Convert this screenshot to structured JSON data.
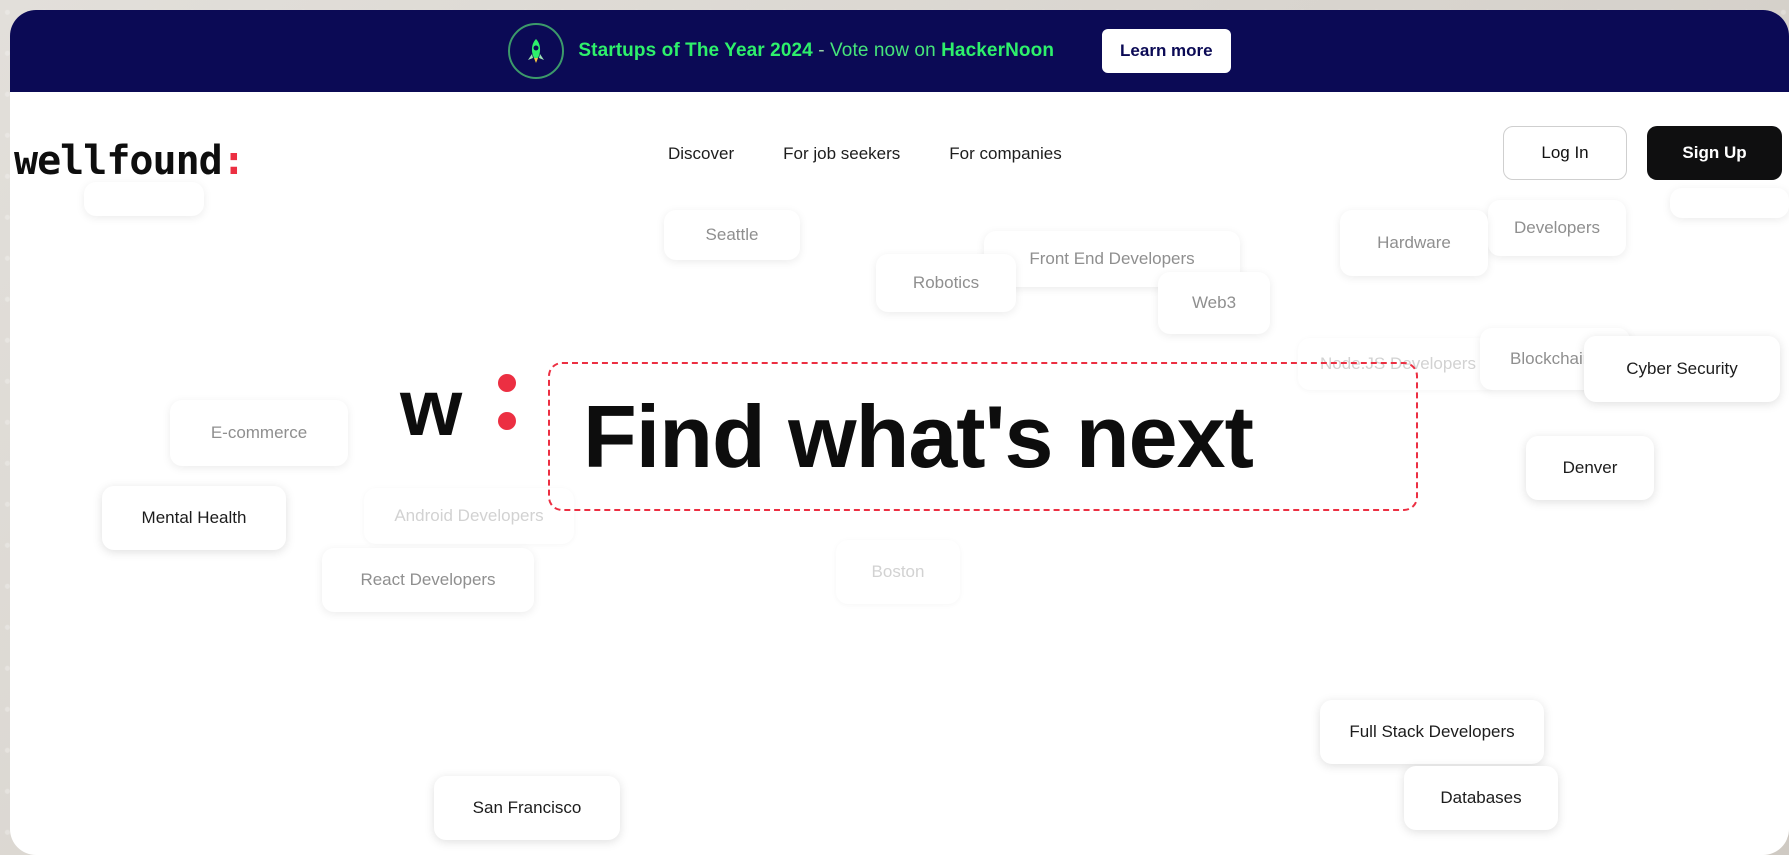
{
  "banner": {
    "highlight_1": "Startups of The Year 2024",
    "separator": " - ",
    "plain": "Vote now on ",
    "highlight_2": "HackerNoon",
    "button": "Learn more"
  },
  "header": {
    "logo_text": "wellfound",
    "logo_colon": ":",
    "nav": [
      "Discover",
      "For job seekers",
      "For companies"
    ],
    "login": "Log In",
    "signup": "Sign Up"
  },
  "hero": {
    "logo_letter": "w",
    "title": "Find what's next"
  },
  "tags": [
    "Seattle",
    "Robotics",
    "Front End Developers",
    "Web3",
    "Hardware",
    "Developers",
    "Node.JS Developers",
    "Blockchain",
    "Cyber Security",
    "E-commerce",
    "Mental Health",
    "Android Developers",
    "React Developers",
    "Boston",
    "Denver",
    "Full Stack Developers",
    "Databases",
    "San Francisco"
  ],
  "colors": {
    "banner_bg": "#0b0a55",
    "banner_text": "#2ef06b",
    "accent_red": "#ec2f42",
    "signup_bg": "#0f0f10"
  }
}
